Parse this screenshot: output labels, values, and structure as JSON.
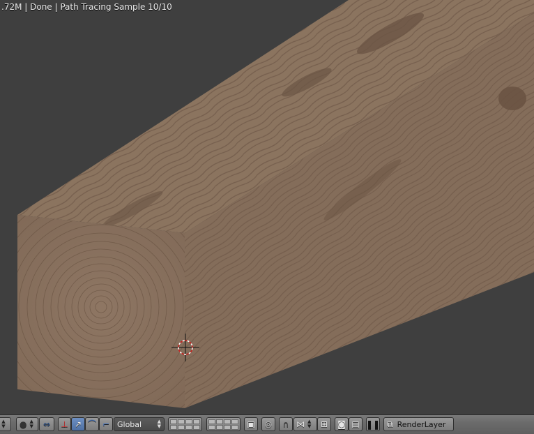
{
  "status_bar": {
    "text": ".72M | Done | Path Tracing Sample 10/10"
  },
  "header": {
    "orientation_select": {
      "value": "Global"
    },
    "render_layer": {
      "label": "RenderLayer"
    }
  },
  "colors": {
    "wood": "#8b735f",
    "wood_dark": "#6d5646",
    "background": "#3f3f3f",
    "header": "#6b6b6b"
  }
}
